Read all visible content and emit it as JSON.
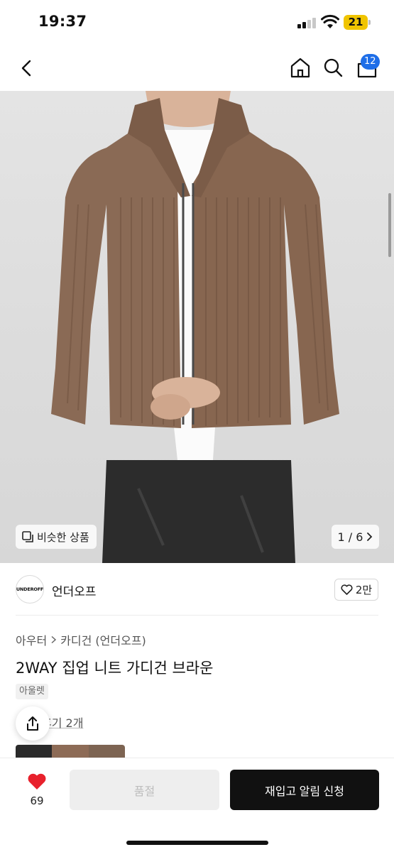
{
  "status_bar": {
    "time": "19:37",
    "battery": "21"
  },
  "nav": {
    "cart_count": "12"
  },
  "gallery": {
    "similar_label": "비슷한 상품",
    "pager": "1 / 6"
  },
  "brand": {
    "logo_text": "UNDEROFF",
    "name": "언더오프",
    "likes": "2만"
  },
  "product": {
    "breadcrumb": [
      "아우터",
      "카디건 (언더오프)"
    ],
    "title": "2WAY 집업 니트 가디건 브라운",
    "tag": "아울렛",
    "review_link": "후기 2개"
  },
  "bottom_bar": {
    "wish_count": "69",
    "soldout_label": "품절",
    "restock_label": "재입고 알림 신청"
  },
  "colors": {
    "accent_blue": "#1e6ee8",
    "heart_red": "#e8212c",
    "sweater_brown": "#8a6a55"
  },
  "icons": [
    "back-icon",
    "home-icon",
    "search-icon",
    "cart-icon",
    "similar-icon",
    "chevron-right-icon",
    "heart-outline-icon",
    "share-icon",
    "heart-icon"
  ]
}
